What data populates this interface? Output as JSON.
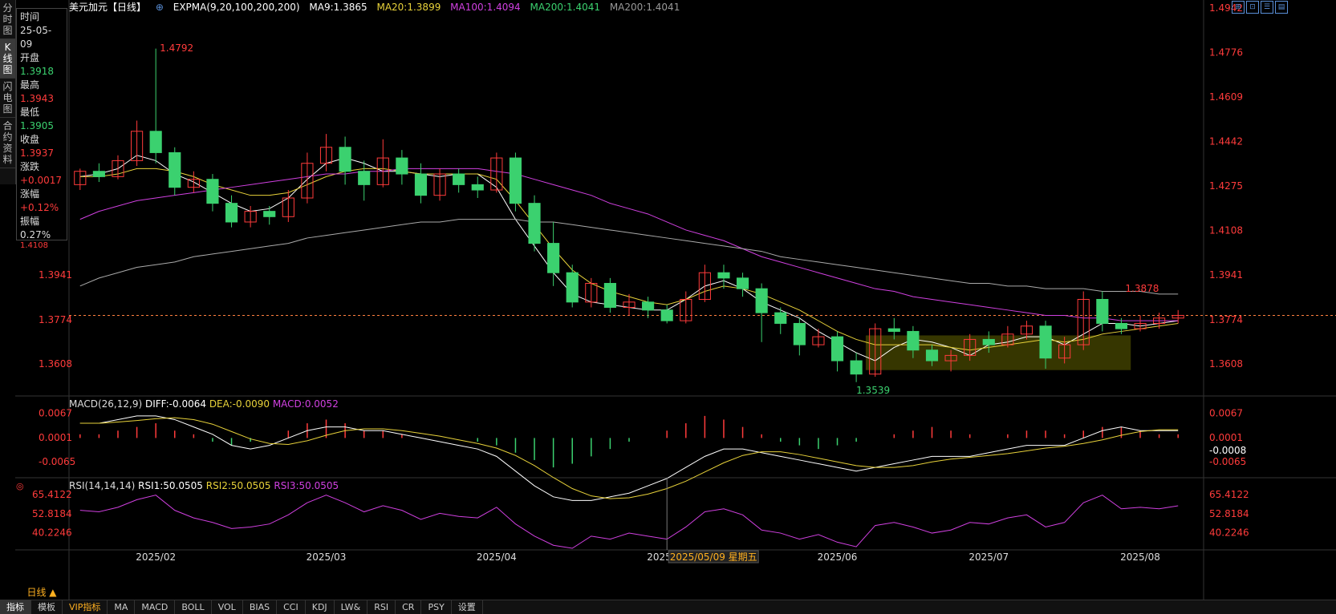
{
  "header": {
    "title": "美元加元【日线】",
    "expma": "EXPMA(9,20,100,200,200)",
    "ma9": "MA9:1.3865",
    "ma20": "MA20:1.3899",
    "ma100": "MA100:1.4094",
    "ma200a": "MA200:1.4041",
    "ma200b": "MA200:1.4041"
  },
  "sidebar": {
    "tabs": [
      "分时图",
      "K线图",
      "闪电图",
      "合约资料"
    ]
  },
  "infobox": {
    "time_label": "时间",
    "time_val": "25-05-09",
    "open_label": "开盘",
    "open_val": "1.3918",
    "high_label": "最高",
    "high_val": "1.3943",
    "low_label": "最低",
    "low_val": "1.3905",
    "close_label": "收盘",
    "close_val": "1.3937",
    "chg_label": "涨跌",
    "chg_val": "+0.0017",
    "pct_label": "涨幅",
    "pct_val": "+0.12%",
    "amp_label": "振幅",
    "amp_val": "0.27%",
    "clipped_val": "1.4108"
  },
  "price_axis": {
    "right_ticks": [
      "1.4942",
      "1.4776",
      "1.4609",
      "1.4442",
      "1.4275",
      "1.4108",
      "1.3941",
      "1.3774",
      "1.3608"
    ],
    "left_ticks": [
      "1.3941",
      "1.3774",
      "1.3608"
    ]
  },
  "annotations": {
    "high": "1.4792",
    "low": "1.3539",
    "recent_high": "1.3878"
  },
  "macd": {
    "title": "MACD(26,12,9)",
    "diff": "DIFF:-0.0064",
    "dea": "DEA:-0.0090",
    "macd": "MACD:0.0052",
    "ticks": [
      "0.0067",
      "0.0001",
      "-0.0065"
    ],
    "current": "-0.0008"
  },
  "rsi": {
    "title": "RSI(14,14,14)",
    "rsi1": "RSI1:50.0505",
    "rsi2": "RSI2:50.0505",
    "rsi3": "RSI3:50.0505",
    "ticks": [
      "65.4122",
      "52.8184",
      "40.2246"
    ]
  },
  "xaxis": {
    "labels": [
      "2025/02",
      "2025/03",
      "2025/04",
      "2025/05",
      "2025/06",
      "2025/07",
      "2025/08"
    ],
    "cursor_label": "2025/05/09 星期五"
  },
  "period_button": "日线 ▲",
  "bottom_tabs": [
    "指标",
    "模板",
    "VIP指标",
    "MA",
    "MACD",
    "BOLL",
    "VOL",
    "BIAS",
    "CCI",
    "KDJ",
    "LW&",
    "RSI",
    "CR",
    "PSY",
    "设置"
  ],
  "colors": {
    "up": "#ff3b3b",
    "down": "#3bd16f",
    "ma9": "#ffffff",
    "ma20": "#e8d23a",
    "ma100": "#d040e0",
    "ma200": "#aaaaaa"
  },
  "chart_data": {
    "type": "candlestick",
    "ylim": [
      1.35,
      1.4942
    ],
    "series": [
      {
        "name": "MA9",
        "y": [
          1.431,
          1.432,
          1.434,
          1.439,
          1.437,
          1.432,
          1.429,
          1.425,
          1.421,
          1.418,
          1.419,
          1.423,
          1.43,
          1.436,
          1.438,
          1.436,
          1.433,
          1.433,
          1.432,
          1.431,
          1.432,
          1.432,
          1.427,
          1.415,
          1.405,
          1.395,
          1.387,
          1.384,
          1.383,
          1.382,
          1.381,
          1.381,
          1.385,
          1.39,
          1.392,
          1.389,
          1.384,
          1.381,
          1.378,
          1.373,
          1.369,
          1.365,
          1.362,
          1.367,
          1.37,
          1.369,
          1.367,
          1.364,
          1.368,
          1.369,
          1.371,
          1.371,
          1.368,
          1.372,
          1.376,
          1.376,
          1.375,
          1.376,
          1.377
        ]
      },
      {
        "name": "MA20",
        "y": [
          1.431,
          1.431,
          1.432,
          1.434,
          1.434,
          1.433,
          1.431,
          1.428,
          1.426,
          1.424,
          1.424,
          1.425,
          1.428,
          1.431,
          1.433,
          1.434,
          1.434,
          1.433,
          1.432,
          1.432,
          1.432,
          1.432,
          1.43,
          1.422,
          1.413,
          1.404,
          1.396,
          1.391,
          1.388,
          1.386,
          1.384,
          1.383,
          1.385,
          1.388,
          1.39,
          1.389,
          1.387,
          1.384,
          1.381,
          1.377,
          1.373,
          1.37,
          1.368,
          1.368,
          1.368,
          1.368,
          1.367,
          1.366,
          1.367,
          1.368,
          1.369,
          1.37,
          1.369,
          1.37,
          1.372,
          1.373,
          1.374,
          1.375,
          1.376
        ]
      },
      {
        "name": "MA100",
        "y": [
          1.415,
          1.418,
          1.42,
          1.422,
          1.423,
          1.424,
          1.425,
          1.426,
          1.427,
          1.428,
          1.429,
          1.43,
          1.431,
          1.432,
          1.432,
          1.433,
          1.433,
          1.434,
          1.434,
          1.434,
          1.434,
          1.434,
          1.433,
          1.432,
          1.43,
          1.428,
          1.426,
          1.424,
          1.421,
          1.419,
          1.417,
          1.414,
          1.411,
          1.409,
          1.407,
          1.404,
          1.401,
          1.399,
          1.397,
          1.395,
          1.393,
          1.391,
          1.389,
          1.388,
          1.386,
          1.385,
          1.384,
          1.383,
          1.382,
          1.381,
          1.38,
          1.379,
          1.379,
          1.378,
          1.378,
          1.377,
          1.377,
          1.377,
          1.377
        ]
      },
      {
        "name": "MA200",
        "y": [
          1.39,
          1.393,
          1.395,
          1.397,
          1.398,
          1.399,
          1.401,
          1.402,
          1.403,
          1.404,
          1.405,
          1.406,
          1.408,
          1.409,
          1.41,
          1.411,
          1.412,
          1.413,
          1.414,
          1.414,
          1.415,
          1.415,
          1.415,
          1.415,
          1.414,
          1.414,
          1.413,
          1.412,
          1.411,
          1.41,
          1.409,
          1.408,
          1.407,
          1.406,
          1.405,
          1.404,
          1.403,
          1.401,
          1.4,
          1.399,
          1.398,
          1.397,
          1.396,
          1.395,
          1.394,
          1.393,
          1.392,
          1.391,
          1.391,
          1.39,
          1.39,
          1.389,
          1.389,
          1.389,
          1.388,
          1.388,
          1.388,
          1.387,
          1.387
        ]
      }
    ],
    "candles": [
      [
        1.428,
        1.433,
        1.426,
        1.434
      ],
      [
        1.433,
        1.431,
        1.429,
        1.436
      ],
      [
        1.431,
        1.437,
        1.43,
        1.439
      ],
      [
        1.437,
        1.448,
        1.435,
        1.452
      ],
      [
        1.448,
        1.44,
        1.436,
        1.479
      ],
      [
        1.44,
        1.427,
        1.424,
        1.442
      ],
      [
        1.427,
        1.43,
        1.425,
        1.433
      ],
      [
        1.43,
        1.421,
        1.418,
        1.432
      ],
      [
        1.421,
        1.414,
        1.412,
        1.424
      ],
      [
        1.414,
        1.418,
        1.412,
        1.42
      ],
      [
        1.418,
        1.416,
        1.413,
        1.42
      ],
      [
        1.416,
        1.423,
        1.414,
        1.426
      ],
      [
        1.423,
        1.436,
        1.421,
        1.44
      ],
      [
        1.436,
        1.442,
        1.433,
        1.447
      ],
      [
        1.442,
        1.433,
        1.428,
        1.446
      ],
      [
        1.433,
        1.428,
        1.422,
        1.437
      ],
      [
        1.428,
        1.438,
        1.427,
        1.445
      ],
      [
        1.438,
        1.432,
        1.428,
        1.441
      ],
      [
        1.432,
        1.424,
        1.421,
        1.436
      ],
      [
        1.424,
        1.432,
        1.422,
        1.434
      ],
      [
        1.432,
        1.428,
        1.425,
        1.434
      ],
      [
        1.428,
        1.426,
        1.423,
        1.431
      ],
      [
        1.426,
        1.438,
        1.425,
        1.44
      ],
      [
        1.438,
        1.421,
        1.418,
        1.44
      ],
      [
        1.421,
        1.406,
        1.403,
        1.424
      ],
      [
        1.406,
        1.395,
        1.39,
        1.414
      ],
      [
        1.395,
        1.384,
        1.382,
        1.398
      ],
      [
        1.384,
        1.391,
        1.382,
        1.393
      ],
      [
        1.391,
        1.382,
        1.38,
        1.393
      ],
      [
        1.382,
        1.384,
        1.379,
        1.387
      ],
      [
        1.384,
        1.381,
        1.378,
        1.386
      ],
      [
        1.381,
        1.377,
        1.376,
        1.383
      ],
      [
        1.377,
        1.385,
        1.376,
        1.388
      ],
      [
        1.385,
        1.395,
        1.384,
        1.398
      ],
      [
        1.395,
        1.393,
        1.389,
        1.398
      ],
      [
        1.393,
        1.389,
        1.386,
        1.395
      ],
      [
        1.389,
        1.38,
        1.369,
        1.391
      ],
      [
        1.38,
        1.376,
        1.372,
        1.382
      ],
      [
        1.376,
        1.368,
        1.364,
        1.378
      ],
      [
        1.368,
        1.371,
        1.367,
        1.374
      ],
      [
        1.371,
        1.362,
        1.358,
        1.373
      ],
      [
        1.362,
        1.357,
        1.354,
        1.365
      ],
      [
        1.357,
        1.374,
        1.356,
        1.376
      ],
      [
        1.374,
        1.373,
        1.37,
        1.378
      ],
      [
        1.373,
        1.366,
        1.363,
        1.375
      ],
      [
        1.366,
        1.362,
        1.36,
        1.368
      ],
      [
        1.362,
        1.364,
        1.358,
        1.366
      ],
      [
        1.364,
        1.37,
        1.362,
        1.372
      ],
      [
        1.37,
        1.368,
        1.365,
        1.373
      ],
      [
        1.368,
        1.372,
        1.367,
        1.375
      ],
      [
        1.372,
        1.375,
        1.37,
        1.377
      ],
      [
        1.375,
        1.363,
        1.359,
        1.377
      ],
      [
        1.363,
        1.368,
        1.361,
        1.371
      ],
      [
        1.368,
        1.385,
        1.366,
        1.388
      ],
      [
        1.385,
        1.376,
        1.373,
        1.388
      ],
      [
        1.376,
        1.374,
        1.372,
        1.378
      ],
      [
        1.374,
        1.376,
        1.373,
        1.379
      ],
      [
        1.376,
        1.378,
        1.374,
        1.38
      ],
      [
        1.378,
        1.379,
        1.376,
        1.381
      ]
    ],
    "macd_hist": [
      0.001,
      0.001,
      0.002,
      0.003,
      0.004,
      0.002,
      0.001,
      -0.001,
      -0.002,
      -0.001,
      0.0,
      0.002,
      0.004,
      0.005,
      0.004,
      0.002,
      0.002,
      0.001,
      0.0,
      0.0,
      0.0,
      -0.001,
      -0.002,
      -0.004,
      -0.006,
      -0.008,
      -0.007,
      -0.005,
      -0.003,
      -0.001,
      0.0,
      0.002,
      0.004,
      0.006,
      0.005,
      0.003,
      0.001,
      -0.001,
      -0.002,
      -0.003,
      -0.002,
      -0.001,
      0.0,
      0.001,
      0.002,
      0.003,
      0.002,
      0.001,
      0.0,
      0.001,
      0.002,
      0.002,
      0.001,
      0.002,
      0.003,
      0.003,
      0.002,
      0.001,
      0.001
    ],
    "macd_diff": [
      0.004,
      0.004,
      0.005,
      0.006,
      0.006,
      0.005,
      0.003,
      0.001,
      -0.002,
      -0.003,
      -0.002,
      0.0,
      0.002,
      0.003,
      0.003,
      0.002,
      0.002,
      0.001,
      0.0,
      -0.001,
      -0.002,
      -0.003,
      -0.005,
      -0.009,
      -0.013,
      -0.016,
      -0.017,
      -0.017,
      -0.016,
      -0.015,
      -0.013,
      -0.011,
      -0.008,
      -0.005,
      -0.003,
      -0.003,
      -0.004,
      -0.005,
      -0.006,
      -0.007,
      -0.008,
      -0.009,
      -0.008,
      -0.007,
      -0.006,
      -0.005,
      -0.005,
      -0.005,
      -0.004,
      -0.003,
      -0.002,
      -0.002,
      -0.002,
      0.0,
      0.002,
      0.003,
      0.002,
      0.002,
      0.002
    ],
    "rsi": [
      55,
      54,
      57,
      62,
      65,
      55,
      50,
      47,
      43,
      44,
      46,
      52,
      60,
      65,
      60,
      54,
      58,
      55,
      49,
      53,
      51,
      50,
      57,
      46,
      38,
      32,
      30,
      38,
      36,
      40,
      38,
      36,
      44,
      54,
      56,
      52,
      42,
      40,
      36,
      39,
      34,
      31,
      45,
      47,
      44,
      40,
      42,
      47,
      46,
      50,
      52,
      44,
      47,
      60,
      65,
      56,
      57,
      56,
      58
    ],
    "xlabels": [
      "2025/02",
      "2025/03",
      "2025/04",
      "2025/05",
      "2025/06",
      "2025/07",
      "2025/08"
    ]
  }
}
